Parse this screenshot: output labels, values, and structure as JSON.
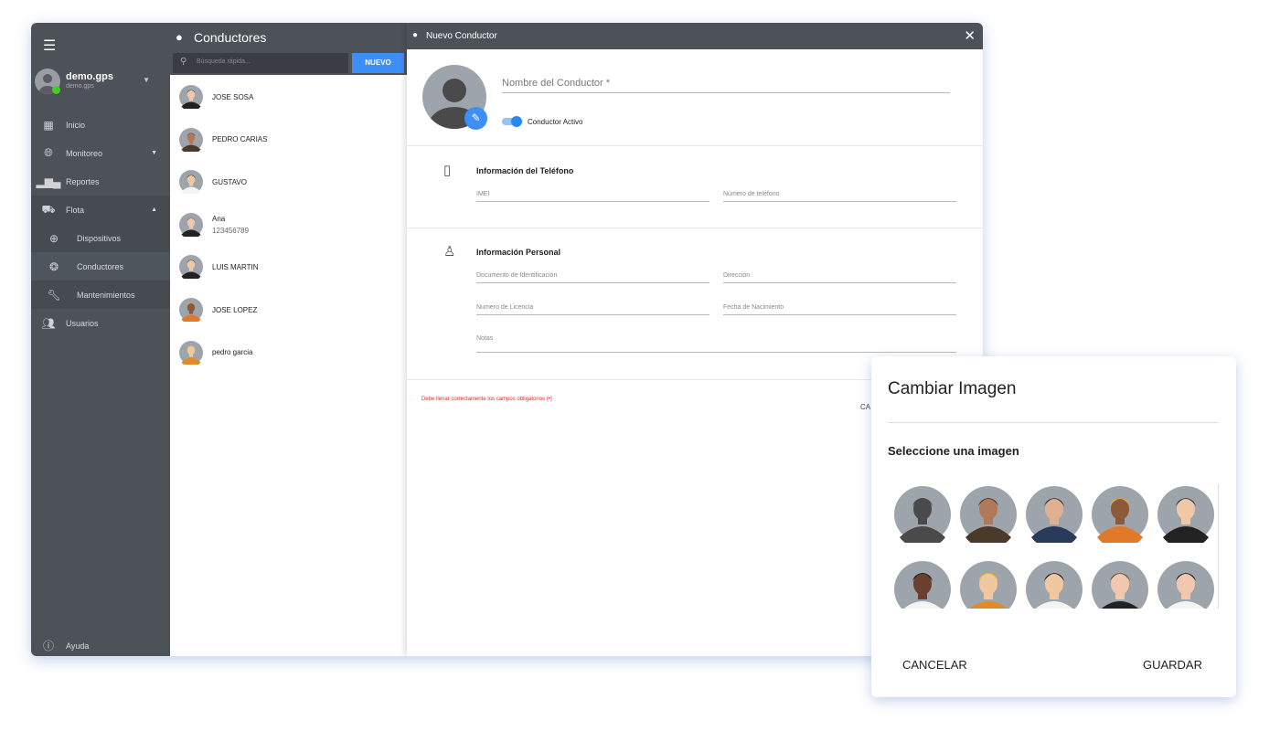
{
  "sidebar": {
    "user": {
      "name": "demo.gps",
      "sub": "demo.gps"
    },
    "items": [
      {
        "label": "Inicio",
        "icon": "dashboard-icon"
      },
      {
        "label": "Monitoreo",
        "icon": "globe-icon"
      },
      {
        "label": "Reportes",
        "icon": "bar-chart-icon"
      },
      {
        "label": "Flota",
        "icon": "car-icon"
      },
      {
        "label": "Dispositivos",
        "icon": "gps-icon"
      },
      {
        "label": "Conductores",
        "icon": "steering-wheel-icon"
      },
      {
        "label": "Mantenimientos",
        "icon": "wrench-icon"
      },
      {
        "label": "Usuarios",
        "icon": "users-icon"
      }
    ],
    "help": "Ayuda",
    "status_color": "#3ed11d"
  },
  "list": {
    "title": "Conductores",
    "search_placeholder": "Búsqueda rápida...",
    "new_label": "NUEVO",
    "drivers": [
      {
        "name": "JOSE SOSA",
        "avatar": 4
      },
      {
        "name": "PEDRO CARIAS",
        "avatar": 1
      },
      {
        "name": "GUSTAVO",
        "avatar": 7
      },
      {
        "name": "Ana",
        "phone": "123456789",
        "avatar": 8
      },
      {
        "name": "LUIS MARTIN",
        "avatar": 4
      },
      {
        "name": "JOSE LOPEZ",
        "avatar": 3
      },
      {
        "name": "pedro garcia",
        "avatar": 6
      }
    ]
  },
  "form": {
    "title": "Nuevo Conductor",
    "name_placeholder": "Nombre del Conductor *",
    "active_label": "Conductor Activo",
    "active": true,
    "phone_section": "Información del Teléfono",
    "imei": "IMEI",
    "phone": "Numero de teléfono",
    "personal_section": "Información Personal",
    "document": "Documento de Identificación",
    "address": "Dirección",
    "license": "Numero de Licencia",
    "birth": "Fecha de Nacimiento",
    "notes": "Notas",
    "error": "Debe llenar correctamente los campos obligatorios (•)",
    "cancel_partial": "CA"
  },
  "dialog": {
    "title": "Cambiar Imagen",
    "subtitle": "Seleccione una imagen",
    "cancel": "CANCELAR",
    "save": "GUARDAR"
  },
  "avatars": [
    {
      "skin": "#4a4a4a",
      "hair": "#4a4a4a",
      "body": "#4a4a4a"
    },
    {
      "skin": "#b07a5a",
      "hair": "#5a3a2a",
      "body": "#4a3a2a"
    },
    {
      "skin": "#e0b090",
      "hair": "#3a3a3a",
      "body": "#2a3a5a"
    },
    {
      "skin": "#8a5a3a",
      "hair": "#f2b41f",
      "body": "#e07a2a"
    },
    {
      "skin": "#f0c8a8",
      "hair": "#3a3a3a",
      "body": "#222222"
    },
    {
      "skin": "#6a4030",
      "hair": "#222222",
      "body": "#f4f4f4"
    },
    {
      "skin": "#f0c8a0",
      "hair": "#f2b41f",
      "body": "#e08a2a"
    },
    {
      "skin": "#f0c8a0",
      "hair": "#222222",
      "body": "#f4f4f4"
    },
    {
      "skin": "#f0c8b0",
      "hair": "#7a4a3a",
      "body": "#222222"
    },
    {
      "skin": "#f0c8b0",
      "hair": "#222222",
      "body": "#f4f4f4"
    }
  ],
  "accent": "#3d8ef5"
}
